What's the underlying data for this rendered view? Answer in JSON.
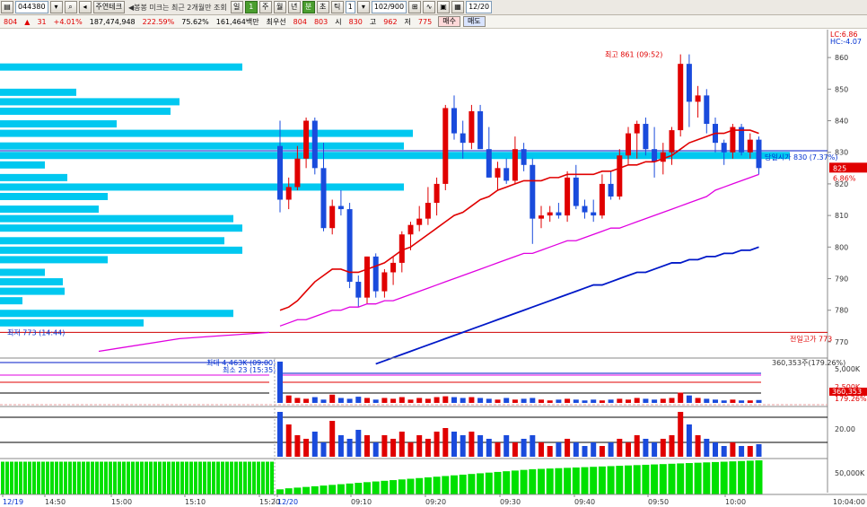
{
  "toolbar": {
    "code": "044380",
    "name": "주연테크",
    "notice": "◀봉봉 미크는 최근 2개월만 조회",
    "periods": [
      "일",
      "1",
      "주",
      "월",
      "년",
      "분",
      "초",
      "틱"
    ],
    "active_period": "분",
    "interval": "1",
    "count": "102/900",
    "date": "12/20"
  },
  "quote": {
    "price": "804",
    "change": "31",
    "change_pct": "+4.01%",
    "volume": "187,474,948",
    "vol_ratio": "222.59%",
    "turnover": "75.62%",
    "amount": "161,464백만",
    "best": "최우선",
    "ask": "804",
    "bid": "803",
    "open_label": "시",
    "open": "830",
    "high_label": "고",
    "high": "962",
    "low_label": "저",
    "low": "775",
    "buy_label": "매수",
    "sell_label": "매도"
  },
  "chart_data": {
    "type": "candlestick",
    "y_range": [
      766,
      866
    ],
    "y_ticks": [
      "860",
      "850",
      "840",
      "830",
      "820",
      "810",
      "800",
      "790",
      "780",
      "770"
    ],
    "x_labels": [
      "12/19",
      "14:50",
      "15:00",
      "15:10",
      "15:20",
      "12/20",
      "09:10",
      "09:20",
      "09:30",
      "09:40",
      "09:50",
      "10:00"
    ],
    "right_top_labels": [
      "LC:6.86",
      "HC:-4.07"
    ],
    "price_tag": "825",
    "price_tag_pct": "6.86%",
    "annotations": {
      "high": "최고 861 (09:52)",
      "low": "최저 773 (14:44)",
      "current": "당일시가 830 (7.37%)",
      "prev_high": "전일고가 773"
    },
    "candles": [
      [
        832,
        840,
        811,
        815
      ],
      [
        815,
        822,
        812,
        819
      ],
      [
        819,
        832,
        818,
        828
      ],
      [
        828,
        841,
        825,
        840
      ],
      [
        840,
        841,
        823,
        825
      ],
      [
        825,
        833,
        805,
        806
      ],
      [
        806,
        815,
        804,
        813
      ],
      [
        813,
        818,
        810,
        812
      ],
      [
        812,
        814,
        787,
        789
      ],
      [
        789,
        791,
        781,
        784
      ],
      [
        784,
        797,
        782,
        797
      ],
      [
        797,
        798,
        784,
        786
      ],
      [
        786,
        793,
        784,
        792
      ],
      [
        792,
        797,
        788,
        795
      ],
      [
        795,
        805,
        792,
        804
      ],
      [
        804,
        808,
        799,
        807
      ],
      [
        807,
        813,
        805,
        809
      ],
      [
        809,
        819,
        807,
        814
      ],
      [
        814,
        822,
        810,
        820
      ],
      [
        820,
        845,
        818,
        844
      ],
      [
        844,
        848,
        834,
        836
      ],
      [
        836,
        840,
        828,
        833
      ],
      [
        833,
        845,
        831,
        843
      ],
      [
        843,
        845,
        832,
        831
      ],
      [
        831,
        838,
        822,
        822
      ],
      [
        822,
        827,
        818,
        825
      ],
      [
        825,
        828,
        820,
        821
      ],
      [
        821,
        835,
        820,
        831
      ],
      [
        831,
        833,
        824,
        826
      ],
      [
        826,
        828,
        801,
        809
      ],
      [
        809,
        813,
        806,
        810
      ],
      [
        810,
        813,
        808,
        811
      ],
      [
        811,
        814,
        809,
        810
      ],
      [
        810,
        824,
        808,
        822
      ],
      [
        822,
        826,
        812,
        813
      ],
      [
        813,
        815,
        809,
        811
      ],
      [
        811,
        815,
        808,
        810
      ],
      [
        810,
        823,
        809,
        820
      ],
      [
        820,
        824,
        815,
        816
      ],
      [
        816,
        831,
        815,
        829
      ],
      [
        829,
        838,
        826,
        836
      ],
      [
        836,
        840,
        828,
        839
      ],
      [
        839,
        841,
        829,
        831
      ],
      [
        831,
        838,
        822,
        827
      ],
      [
        827,
        833,
        823,
        830
      ],
      [
        830,
        838,
        826,
        837
      ],
      [
        837,
        861,
        835,
        858
      ],
      [
        858,
        861,
        838,
        846
      ],
      [
        846,
        851,
        841,
        848
      ],
      [
        848,
        850,
        836,
        839
      ],
      [
        839,
        841,
        830,
        833
      ],
      [
        833,
        834,
        826,
        830
      ],
      [
        830,
        839,
        828,
        838
      ],
      [
        838,
        839,
        829,
        830
      ],
      [
        830,
        836,
        828,
        834
      ],
      [
        834,
        835,
        823,
        825
      ]
    ],
    "prev_day_candles": [],
    "volume_profile": [
      {
        "price": 857,
        "width": 270
      },
      {
        "price": 853,
        "width": 0
      },
      {
        "price": 849,
        "width": 85
      },
      {
        "price": 846,
        "width": 200
      },
      {
        "price": 843,
        "width": 190
      },
      {
        "price": 839,
        "width": 130
      },
      {
        "price": 836,
        "width": 460
      },
      {
        "price": 832,
        "width": 450
      },
      {
        "price": 829,
        "width": 880
      },
      {
        "price": 826,
        "width": 50
      },
      {
        "price": 822,
        "width": 75
      },
      {
        "price": 819,
        "width": 450
      },
      {
        "price": 816,
        "width": 120
      },
      {
        "price": 812,
        "width": 110
      },
      {
        "price": 809,
        "width": 260
      },
      {
        "price": 806,
        "width": 270
      },
      {
        "price": 802,
        "width": 250
      },
      {
        "price": 799,
        "width": 270
      },
      {
        "price": 796,
        "width": 120
      },
      {
        "price": 792,
        "width": 50
      },
      {
        "price": 789,
        "width": 70
      },
      {
        "price": 786,
        "width": 72
      },
      {
        "price": 783,
        "width": 25
      },
      {
        "price": 779,
        "width": 260
      },
      {
        "price": 776,
        "width": 160
      }
    ],
    "ma_red": [
      780,
      781,
      783,
      786,
      789,
      791,
      793,
      793,
      792,
      792,
      793,
      794,
      795,
      797,
      799,
      800,
      802,
      804,
      806,
      808,
      810,
      811,
      813,
      815,
      816,
      818,
      819,
      820,
      821,
      821,
      821,
      822,
      822,
      823,
      823,
      823,
      823,
      824,
      824,
      825,
      826,
      826,
      827,
      827,
      828,
      829,
      831,
      833,
      834,
      835,
      836,
      836,
      837,
      837,
      837,
      836
    ],
    "ma_pink": [
      775,
      776,
      777,
      777,
      778,
      779,
      780,
      780,
      781,
      781,
      782,
      782,
      783,
      783,
      784,
      785,
      786,
      787,
      788,
      789,
      790,
      791,
      792,
      793,
      794,
      795,
      796,
      797,
      798,
      798,
      799,
      800,
      801,
      802,
      802,
      803,
      804,
      805,
      806,
      806,
      807,
      808,
      809,
      810,
      811,
      812,
      813,
      814,
      815,
      816,
      818,
      819,
      820,
      821,
      822,
      823
    ],
    "ma_blue": [
      763,
      764,
      765,
      766,
      767,
      768,
      769,
      770,
      771,
      772,
      773,
      774,
      775,
      776,
      777,
      778,
      779,
      780,
      781,
      782,
      783,
      784,
      785,
      786,
      787,
      788,
      788,
      789,
      790,
      791,
      792,
      792,
      793,
      794,
      795,
      795,
      796,
      796,
      797,
      797,
      798,
      798,
      799,
      799,
      800
    ],
    "sub_volume_labels": [
      "최대 4,463K (09:00)",
      "최소 23 (15:35)",
      "360,353주(179.26%)"
    ],
    "sub_volume_ticks": [
      "5,000K",
      "2,500K",
      "179.26%"
    ],
    "sub_volume_tag": "360,353",
    "volume": [
      100,
      18,
      12,
      10,
      14,
      8,
      20,
      12,
      10,
      15,
      12,
      8,
      12,
      10,
      14,
      8,
      12,
      10,
      14,
      16,
      14,
      12,
      14,
      12,
      10,
      8,
      12,
      8,
      10,
      12,
      8,
      6,
      8,
      10,
      8,
      6,
      8,
      6,
      8,
      10,
      8,
      12,
      10,
      8,
      10,
      12,
      25,
      18,
      12,
      10,
      8,
      6,
      8,
      6,
      6,
      7
    ],
    "sub2_ticks": [
      "20.00"
    ],
    "sub3_ticks": [
      "50,000K"
    ],
    "cum_volume": [
      0.15,
      0.18,
      0.2,
      0.22,
      0.24,
      0.26,
      0.28,
      0.3,
      0.32,
      0.34,
      0.36,
      0.38,
      0.4,
      0.42,
      0.44,
      0.46,
      0.48,
      0.5,
      0.52,
      0.54,
      0.56,
      0.58,
      0.6,
      0.62,
      0.64,
      0.66,
      0.68,
      0.7,
      0.72,
      0.74,
      0.75,
      0.76,
      0.77,
      0.78,
      0.79,
      0.8,
      0.81,
      0.82,
      0.83,
      0.84,
      0.85,
      0.86,
      0.87,
      0.88,
      0.89,
      0.9,
      0.91,
      0.92,
      0.93,
      0.94,
      0.95,
      0.96,
      0.97,
      0.98,
      0.99,
      1.0
    ],
    "prev_cum_volume_level": 0.96,
    "time_right": "10:04:00",
    "colors": {
      "up": "#e00000",
      "down": "#1a4bdc",
      "profile": "#00c8f0",
      "ma_red": "#e00000",
      "ma_pink": "#e000e0",
      "ma_blue": "#0018c8",
      "cum": "#00e000"
    }
  }
}
